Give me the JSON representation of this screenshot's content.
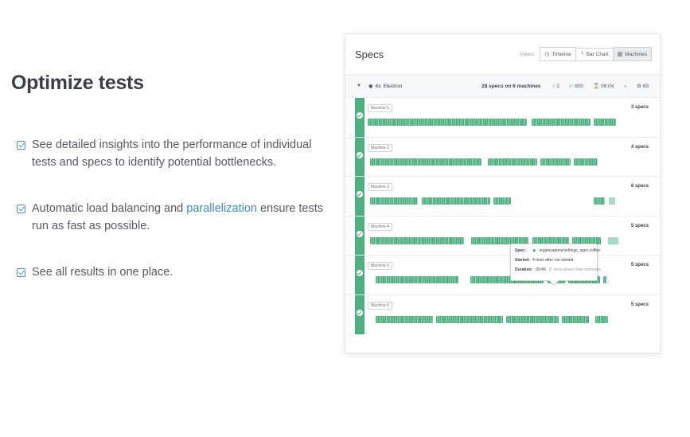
{
  "left": {
    "heading": "Optimize tests",
    "features": [
      {
        "text": "See detailed insights into the performance of individual tests and specs to identify potential bottlenecks."
      },
      {
        "text_before": "Automatic load balancing and ",
        "link": "parallelization",
        "text_after": " ensure tests run as fast as possible."
      },
      {
        "text": "See all results in one place."
      }
    ]
  },
  "panel": {
    "title": "Specs",
    "views_label": "Views:",
    "view_buttons": [
      {
        "label": "Timeline",
        "icon": "clock-icon",
        "glyph": "◷"
      },
      {
        "label": "Bar Chart",
        "icon": "bar-chart-icon",
        "glyph": "└"
      },
      {
        "label": "Machines",
        "icon": "grid-icon",
        "glyph": "▦"
      }
    ],
    "run": {
      "browser": "Electron",
      "browser_prefix": "6x",
      "summary": "28 specs on 6 machines",
      "pending": "2",
      "passed": "800",
      "duration": "06:04",
      "extra": "69"
    },
    "machines": [
      {
        "label": "Machine 1",
        "count": "3 specs"
      },
      {
        "label": "Machine 2",
        "count": "4 specs"
      },
      {
        "label": "Machine 3",
        "count": "6 specs"
      },
      {
        "label": "Machine 4",
        "count": "5 specs"
      },
      {
        "label": "Machine 5",
        "count": "5 specs"
      },
      {
        "label": "Machine 6",
        "count": "5 specs"
      }
    ],
    "tooltip": {
      "spec_key": "Spec:",
      "spec_value": "organizations/settings_spec.coffee",
      "started_key": "Started:",
      "started_value": "4 mins after run started",
      "duration_key": "Duration:",
      "duration_value": "00:49",
      "duration_note": "(2 secs slower than estimate)"
    }
  },
  "colors": {
    "accent": "#3d8ec9",
    "pass_green": "#4eb07e",
    "bar_green": "#4fae80"
  }
}
